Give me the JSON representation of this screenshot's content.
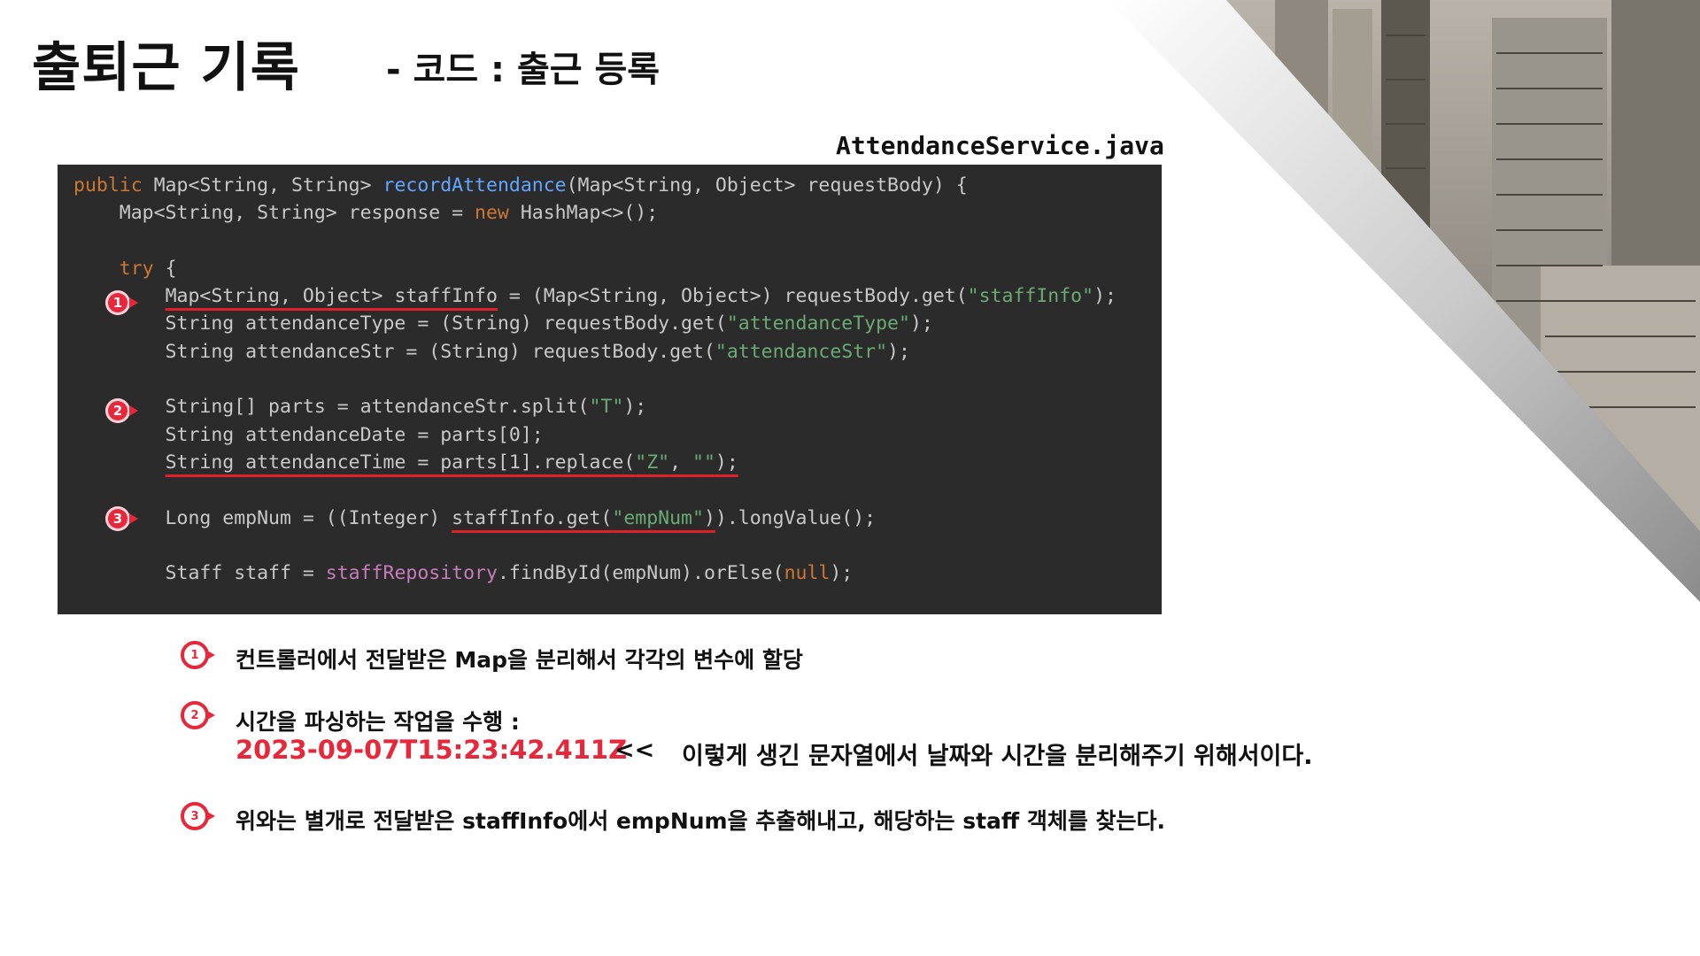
{
  "title": "출퇴근 기록",
  "subtitle": "- 코드 : 출근 등록",
  "filename": "AttendanceService.java",
  "badges": [
    "1",
    "2",
    "3"
  ],
  "notes": {
    "n1": "컨트롤러에서 전달받은 Map을 분리해서 각각의 변수에 할당",
    "n2": "시간을 파싱하는 작업을 수행 :",
    "n2_time": "2023-09-07T15:23:42.411Z",
    "n2_arrow": "<<",
    "n2_explain": "이렇게 생긴 문자열에서 날짜와 시간을 분리해주기 위해서이다.",
    "n3": "위와는 별개로 전달받은 staffInfo에서 empNum을 추출해내고, 해당하는 staff 객체를 찾는다."
  },
  "colors": {
    "accent": "#e8283a",
    "code_bg": "#2b2b2b",
    "keyword": "#cc7832",
    "method": "#61a6ff",
    "string": "#6aab73",
    "field": "#c77dbb"
  }
}
